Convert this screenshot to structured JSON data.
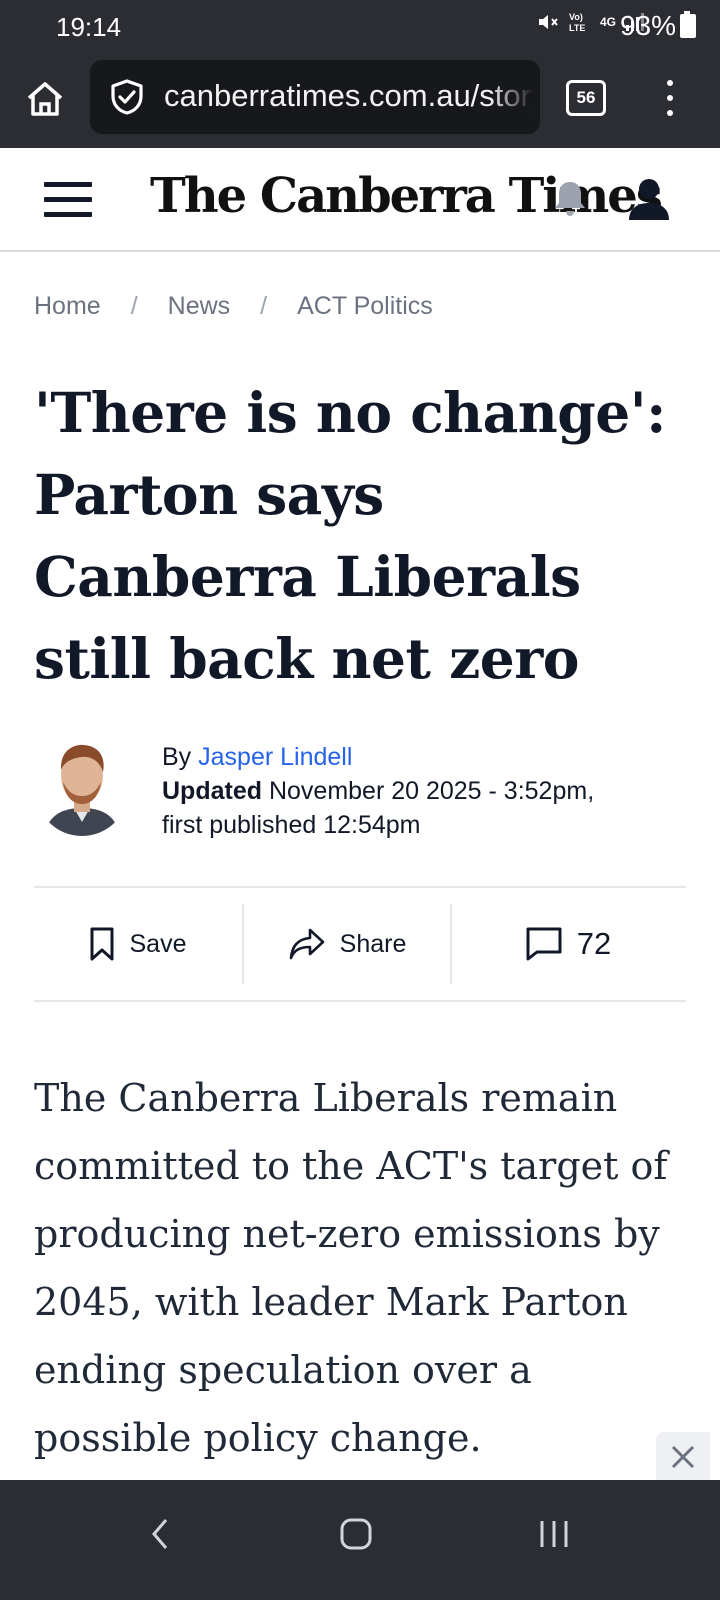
{
  "status_bar": {
    "time": "19:14",
    "network": "4G",
    "battery": "93%"
  },
  "browser": {
    "url": "canberratimes.com.au/story",
    "tab_count": "56"
  },
  "site": {
    "masthead": "The Canberra Times"
  },
  "breadcrumbs": [
    "Home",
    "News",
    "ACT Politics"
  ],
  "breadcrumb_separator": "/",
  "article": {
    "headline": "'There is no change': Parton says Canberra Liberals still back net zero",
    "byline_prefix": "By",
    "author": "Jasper Lindell",
    "updated_label": "Updated",
    "updated_value": "November 20 2025 - 3:52pm,",
    "first_published": "first published 12:54pm",
    "lede": "The Canberra Liberals remain committed to the ACT's target of producing net-zero emissions by 2045, with leader Mark Parton ending speculation over a possible policy change."
  },
  "actions": {
    "save_label": "Save",
    "share_label": "Share",
    "comments_count": "72"
  },
  "colors": {
    "chrome_bg": "#2b2d33",
    "author_link": "#2563eb",
    "headline": "#111827"
  }
}
